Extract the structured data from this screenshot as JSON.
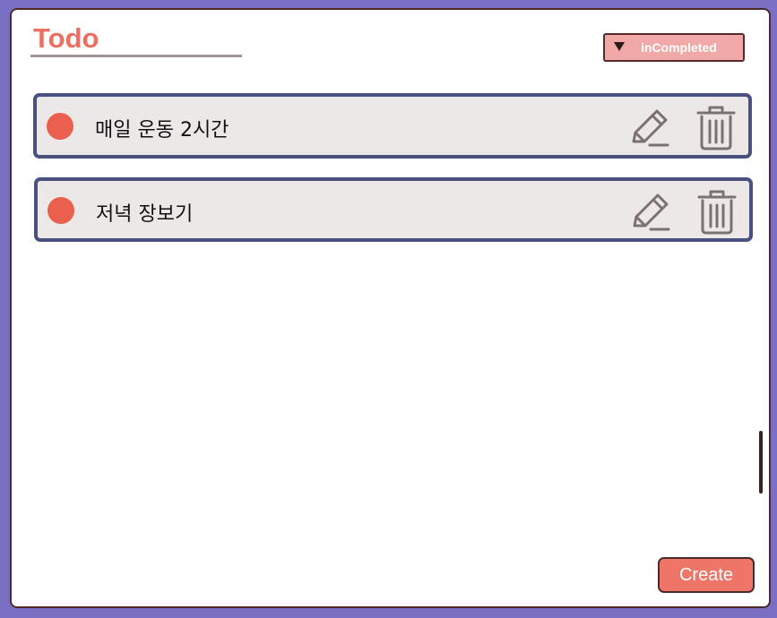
{
  "header": {
    "title": "Todo",
    "filter_label": "inCompleted"
  },
  "todos": [
    {
      "text": "매일 운동 2시간"
    },
    {
      "text": "저녁 장보기"
    }
  ],
  "footer": {
    "create_label": "Create"
  },
  "colors": {
    "accent": "#ec6f63",
    "item_border": "#4a5080",
    "item_bg": "#ede8e8",
    "status_dot": "#eb5f4e",
    "background": "#7b6fc4"
  },
  "icons": {
    "edit": "pencil-icon",
    "delete": "trash-icon",
    "filter": "caret-down-icon"
  }
}
